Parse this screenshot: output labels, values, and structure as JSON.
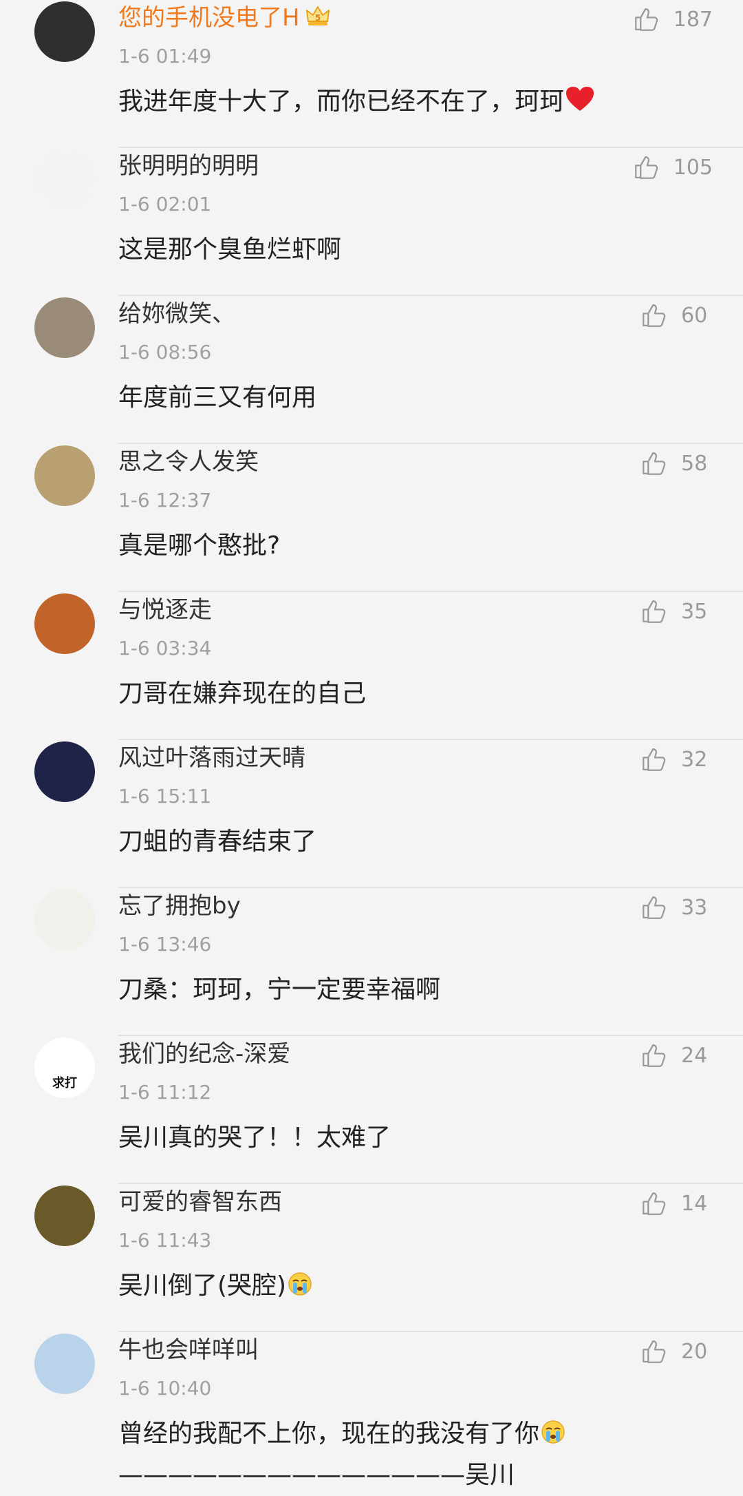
{
  "comments": [
    {
      "username": "您的手机没电了H",
      "vip": true,
      "time": "1-6 01:49",
      "text": "我进年度十大了，而你已经不在了，珂珂",
      "emoji": "heart",
      "likes": "187",
      "avatar": {
        "bg": "#2f2f2f",
        "label": ""
      }
    },
    {
      "username": "张明明的明明",
      "vip": false,
      "time": "1-6 02:01",
      "text": "这是那个臭鱼烂虾啊",
      "emoji": "",
      "likes": "105",
      "avatar": {
        "bg": "#f3f3f3",
        "label": ""
      }
    },
    {
      "username": "给妳微笑、",
      "vip": false,
      "time": "1-6 08:56",
      "text": "年度前三又有何用",
      "emoji": "",
      "likes": "60",
      "avatar": {
        "bg": "#9a8a78",
        "label": ""
      }
    },
    {
      "username": "思之令人发笑",
      "vip": false,
      "time": "1-6 12:37",
      "text": "真是哪个憨批?",
      "emoji": "",
      "likes": "58",
      "avatar": {
        "bg": "#b8a070",
        "label": ""
      }
    },
    {
      "username": "与悦逐走",
      "vip": false,
      "time": "1-6 03:34",
      "text": "刀哥在嫌弃现在的自己",
      "emoji": "",
      "likes": "35",
      "avatar": {
        "bg": "#c0642a",
        "label": ""
      }
    },
    {
      "username": "风过叶落雨过天晴",
      "vip": false,
      "time": "1-6 15:11",
      "text": "刀蛆的青春结束了",
      "emoji": "",
      "likes": "32",
      "avatar": {
        "bg": "#1f2347",
        "label": ""
      }
    },
    {
      "username": "忘了拥抱by",
      "vip": false,
      "time": "1-6 13:46",
      "text": "刀桑：珂珂，宁一定要幸福啊",
      "emoji": "",
      "likes": "33",
      "avatar": {
        "bg": "#eef2ea",
        "label": ""
      }
    },
    {
      "username": "我们的纪念-深爱",
      "vip": false,
      "time": "1-6 11:12",
      "text": "吴川真的哭了！！太难了",
      "emoji": "",
      "likes": "24",
      "avatar": {
        "bg": "#ffffff",
        "label": "求打"
      }
    },
    {
      "username": "可爱的睿智东西",
      "vip": false,
      "time": "1-6 11:43",
      "text": "吴川倒了(哭腔)",
      "emoji": "cry",
      "likes": "14",
      "avatar": {
        "bg": "#6a5a2a",
        "label": ""
      }
    },
    {
      "username": "牛也会咩咩叫",
      "vip": false,
      "time": "1-6 10:40",
      "text": "曾经的我配不上你，现在的我没有了你",
      "text2": "——————————————吴川",
      "emoji": "cry",
      "likes": "20",
      "avatar": {
        "bg": "#b9d3ea",
        "label": ""
      }
    }
  ],
  "colors": {
    "vip_name": "#f07a1d",
    "name": "#333333",
    "time": "#a0a0a0",
    "like": "#9a9a9a",
    "background": "#f4f4f4"
  },
  "icons": {
    "like": "thumbs-up-icon",
    "vip": "crown-badge-icon"
  }
}
